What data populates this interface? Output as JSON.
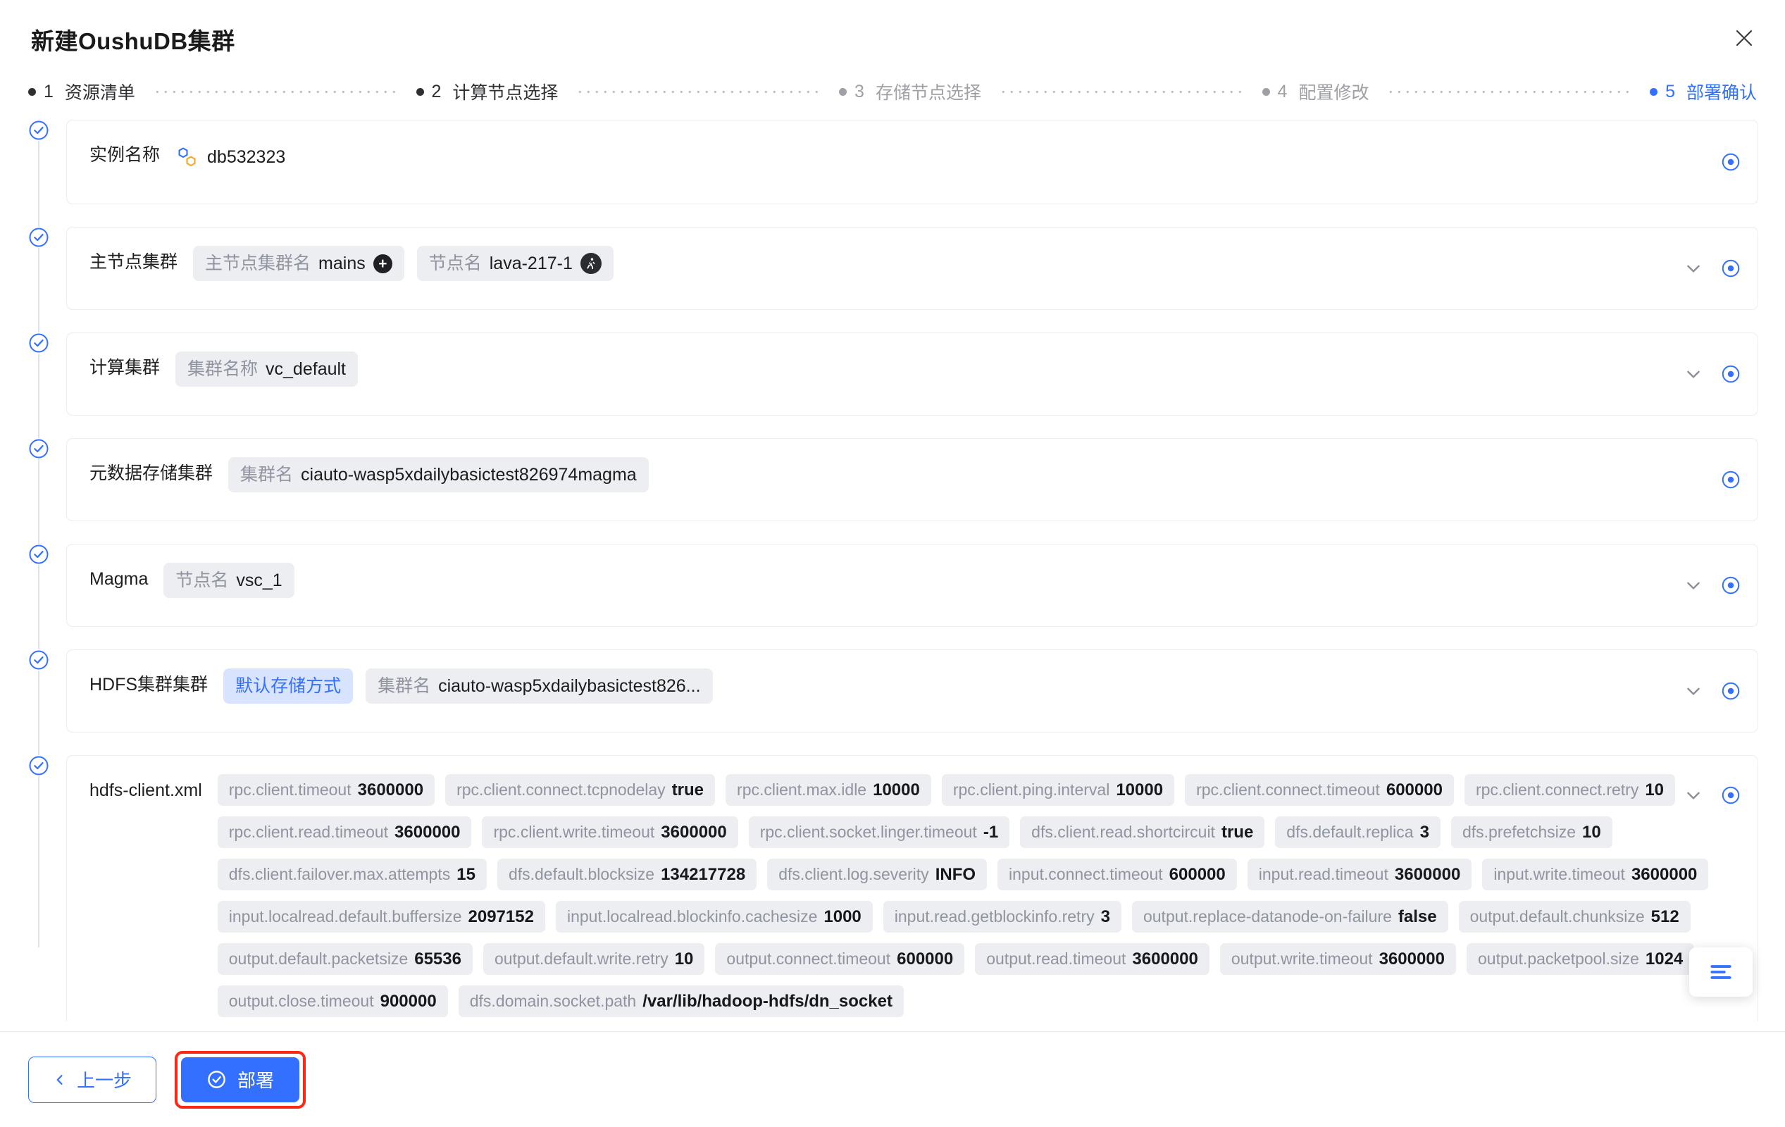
{
  "modal": {
    "title": "新建OushuDB集群",
    "close_icon": "close-icon"
  },
  "stepper": {
    "steps": [
      {
        "num": "1",
        "label": "资源清单",
        "state": "done"
      },
      {
        "num": "2",
        "label": "计算节点选择",
        "state": "done"
      },
      {
        "num": "3",
        "label": "存储节点选择",
        "state": "inactive"
      },
      {
        "num": "4",
        "label": "配置修改",
        "state": "inactive"
      },
      {
        "num": "5",
        "label": "部署确认",
        "state": "current"
      }
    ],
    "active_color": "#3370ff",
    "done_color": "#2f2f33",
    "inactive_color": "#9ea0a6"
  },
  "rows": {
    "instance": {
      "label": "实例名称",
      "icon": "nodes-icon",
      "value": "db532323"
    },
    "master": {
      "label": "主节点集群",
      "pill_cluster_key": "主节点集群名",
      "pill_cluster_value": "mains",
      "add_icon": "plus-circle-icon",
      "pill_node_key": "节点名",
      "pill_node_value": "lava-217-1",
      "run_icon": "running-person-icon"
    },
    "compute": {
      "label": "计算集群",
      "pill_key": "集群名称",
      "pill_value": "vc_default"
    },
    "metadata": {
      "label": "元数据存储集群",
      "pill_key": "集群名",
      "pill_value": "ciauto-wasp5xdailybasictest826974magma"
    },
    "magma": {
      "label": "Magma",
      "pill_key": "节点名",
      "pill_value": "vsc_1"
    },
    "hdfs": {
      "label": "HDFS集群集群",
      "badge": "默认存储方式",
      "pill_key": "集群名",
      "pill_value": "ciauto-wasp5xdailybasictest826..."
    },
    "hdfs_client": {
      "label": "hdfs-client.xml",
      "tags": [
        {
          "k": "rpc.client.timeout",
          "v": "3600000"
        },
        {
          "k": "rpc.client.connect.tcpnodelay",
          "v": "true"
        },
        {
          "k": "rpc.client.max.idle",
          "v": "10000"
        },
        {
          "k": "rpc.client.ping.interval",
          "v": "10000"
        },
        {
          "k": "rpc.client.connect.timeout",
          "v": "600000"
        },
        {
          "k": "rpc.client.connect.retry",
          "v": "10"
        },
        {
          "k": "rpc.client.read.timeout",
          "v": "3600000"
        },
        {
          "k": "rpc.client.write.timeout",
          "v": "3600000"
        },
        {
          "k": "rpc.client.socket.linger.timeout",
          "v": "-1"
        },
        {
          "k": "dfs.client.read.shortcircuit",
          "v": "true"
        },
        {
          "k": "dfs.default.replica",
          "v": "3"
        },
        {
          "k": "dfs.prefetchsize",
          "v": "10"
        },
        {
          "k": "dfs.client.failover.max.attempts",
          "v": "15"
        },
        {
          "k": "dfs.default.blocksize",
          "v": "134217728"
        },
        {
          "k": "dfs.client.log.severity",
          "v": "INFO"
        },
        {
          "k": "input.connect.timeout",
          "v": "600000"
        },
        {
          "k": "input.read.timeout",
          "v": "3600000"
        },
        {
          "k": "input.write.timeout",
          "v": "3600000"
        },
        {
          "k": "input.localread.default.buffersize",
          "v": "2097152"
        },
        {
          "k": "input.localread.blockinfo.cachesize",
          "v": "1000"
        },
        {
          "k": "input.read.getblockinfo.retry",
          "v": "3"
        },
        {
          "k": "output.replace-datanode-on-failure",
          "v": "false"
        },
        {
          "k": "output.default.chunksize",
          "v": "512"
        },
        {
          "k": "output.default.packetsize",
          "v": "65536"
        },
        {
          "k": "output.default.write.retry",
          "v": "10"
        },
        {
          "k": "output.connect.timeout",
          "v": "600000"
        },
        {
          "k": "output.read.timeout",
          "v": "3600000"
        },
        {
          "k": "output.write.timeout",
          "v": "3600000"
        },
        {
          "k": "output.packetpool.size",
          "v": "1024"
        },
        {
          "k": "output.close.timeout",
          "v": "900000"
        },
        {
          "k": "dfs.domain.socket.path",
          "v": "/var/lib/hadoop-hdfs/dn_socket"
        }
      ]
    }
  },
  "floating": {
    "icon": "menu-list-icon"
  },
  "footer": {
    "prev_label": "上一步",
    "prev_icon": "chevron-left-icon",
    "deploy_label": "部署",
    "deploy_icon": "check-circle-icon",
    "deploy_highlight_color": "#fe2712",
    "primary_color": "#3370ff"
  }
}
